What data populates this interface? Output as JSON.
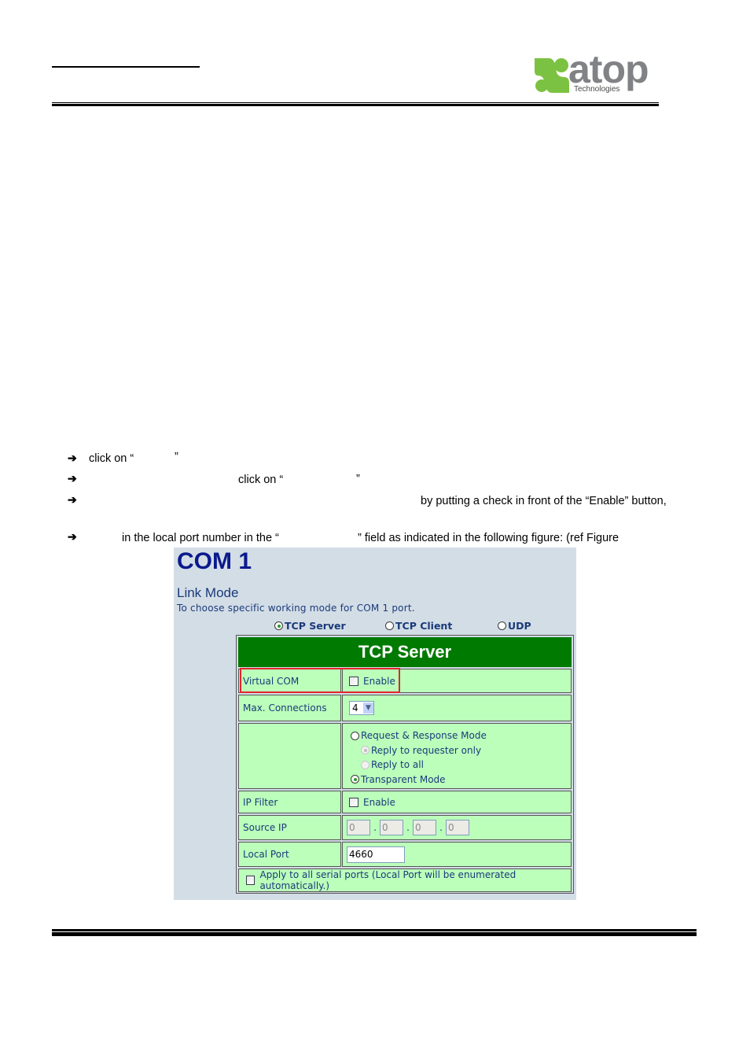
{
  "header": {
    "logo": {
      "wordmark": "atop",
      "tagline": "Technologies",
      "brand_green": "#7cc242",
      "brand_gray": "#808285"
    }
  },
  "instructions": [
    {
      "arrow": "➔",
      "parts": [
        "click on “",
        "”"
      ]
    },
    {
      "arrow": "➔",
      "parts": [
        "click on “",
        "”"
      ]
    },
    {
      "arrow": "➔",
      "parts": [
        "by putting a check in front of the “Enable” button,"
      ]
    },
    {
      "arrow": "➔",
      "parts": [
        "in the local port number in the “",
        "” field as indicated in the following figure: (ref Figure"
      ]
    }
  ],
  "figure": {
    "title": "COM 1",
    "link_mode_heading": "Link Mode",
    "link_mode_desc": "To choose specific working mode for COM 1 port.",
    "link_modes": [
      {
        "label": "TCP Server",
        "selected": true
      },
      {
        "label": "TCP Client",
        "selected": false
      },
      {
        "label": "UDP",
        "selected": false
      }
    ],
    "table_title": "TCP Server",
    "rows": {
      "virtual_com": {
        "label": "Virtual COM",
        "checkbox_label": "Enable",
        "checked": false
      },
      "max_connections": {
        "label": "Max. Connections",
        "value": "4"
      },
      "modes": {
        "label": "",
        "options": [
          {
            "label": "Request & Response Mode",
            "selected": false,
            "disabled": false,
            "sub": false
          },
          {
            "label": "Reply to requester only",
            "selected": true,
            "disabled": true,
            "sub": true
          },
          {
            "label": "Reply to all",
            "selected": false,
            "disabled": true,
            "sub": true
          },
          {
            "label": "Transparent Mode",
            "selected": true,
            "disabled": false,
            "sub": false
          }
        ]
      },
      "ip_filter": {
        "label": "IP Filter",
        "checkbox_label": "Enable",
        "checked": false
      },
      "source_ip": {
        "label": "Source IP",
        "octets": [
          "0",
          "0",
          "0",
          "0"
        ],
        "separator": "."
      },
      "local_port": {
        "label": "Local Port",
        "value": "4660"
      },
      "apply_all": {
        "label": "Apply to all serial ports (Local Port will be enumerated automatically.)",
        "checked": false
      }
    },
    "colors": {
      "panel_bg": "#d3dde6",
      "title_blue": "#0a1a8c",
      "header_green": "#007a00",
      "cell_green": "#bbffbb",
      "highlight_red": "#e0262b"
    }
  }
}
